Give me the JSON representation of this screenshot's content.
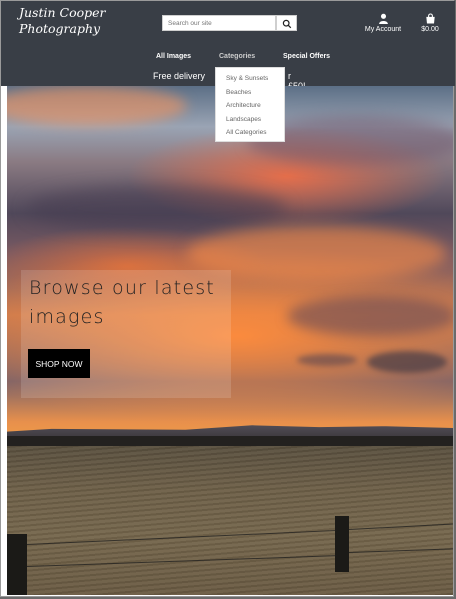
{
  "brand": {
    "line1": "Justin Cooper",
    "line2": "Photography"
  },
  "search": {
    "placeholder": "Search our site"
  },
  "account": {
    "label": "My Account",
    "icon": "user-icon"
  },
  "cart": {
    "total": "$0.00",
    "icon": "shopping-bag-icon"
  },
  "nav": {
    "all_images": "All Images",
    "categories": "Categories",
    "special_offers": "Special Offers"
  },
  "delivery": {
    "before": "Free delivery",
    "after": "r £50!"
  },
  "categories_menu": [
    "Sky & Sunsets",
    "Beaches",
    "Architecture",
    "Landscapes",
    "All Categories"
  ],
  "hero": {
    "title": "Browse our latest images",
    "button": "SHOP NOW"
  },
  "colors": {
    "navbar": "#393e46",
    "button": "#000000",
    "text_light": "#ffffff"
  }
}
